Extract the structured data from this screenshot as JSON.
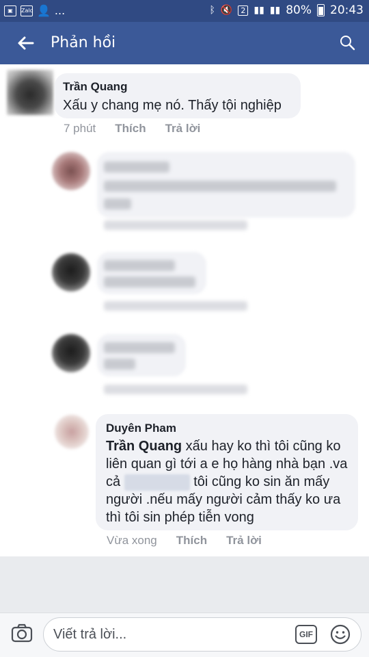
{
  "status_bar": {
    "left_icons": [
      "image-icon",
      "zalo-icon",
      "person-add-icon"
    ],
    "dots": "...",
    "sim_badge": "2",
    "battery": "80%",
    "time": "20:43"
  },
  "app_bar": {
    "title": "Phản hồi"
  },
  "comments": [
    {
      "author": "Trần Quang",
      "text": "Xấu y chang mẹ nó. Thấy tội nghiệp",
      "time": "7 phút",
      "like": "Thích",
      "reply": "Trả lời"
    }
  ],
  "reply": {
    "author": "Duyên Pham",
    "mention": "Trần Quang",
    "text_1": " xấu hay ko thì tôi cũng ko liên quan gì tới a e họ hàng nhà bạn .va cả ",
    "text_2": " tôi cũng ko sin ăn mấy người .nếu mấy người cảm thấy ko ưa thì tôi sin phép tiễn vong",
    "time": "Vừa xong",
    "like": "Thích",
    "reply": "Trả lời"
  },
  "composer": {
    "placeholder": "Viết trả lời...",
    "gif_label": "GIF"
  }
}
